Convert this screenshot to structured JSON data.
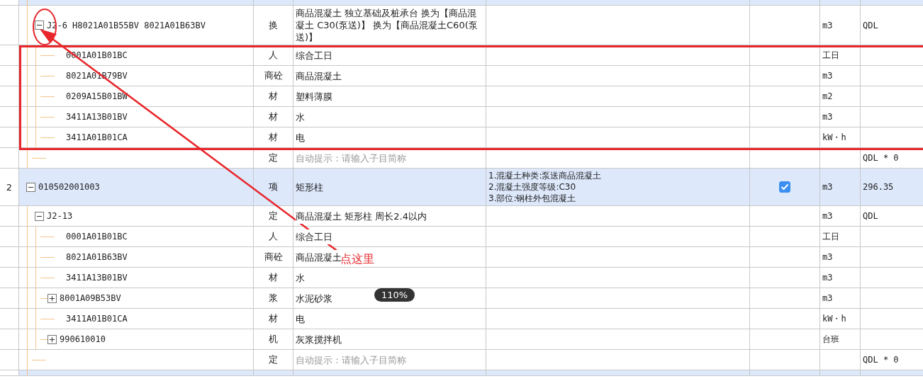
{
  "rows": [
    {
      "kind": "item_cut",
      "children": [
        {
          "kind": "quota",
          "code": "J2-6 H8021A01B55BV 8021A01B63BV",
          "type": "换",
          "name": "商品混凝土 独立基础及桩承台  换为【商品混凝土 C30(泵送)】  换为【商品混凝土C60(泵送)】",
          "unit": "m3",
          "quantity": "QDL",
          "expanded": true,
          "children": [
            {
              "kind": "resource",
              "code": "0001A01B01BC",
              "type": "人",
              "name": "综合工日",
              "unit": "工日"
            },
            {
              "kind": "resource",
              "code": "8021A01B79BV",
              "type": "商砼",
              "name": "商品混凝土",
              "unit": "m3"
            },
            {
              "kind": "resource",
              "code": "0209A15B01BW",
              "type": "材",
              "name": "塑料薄膜",
              "unit": "m2"
            },
            {
              "kind": "resource",
              "code": "3411A13B01BV",
              "type": "材",
              "name": "水",
              "unit": "m3"
            },
            {
              "kind": "resource",
              "code": "3411A01B01CA",
              "type": "材",
              "name": "电",
              "unit": "kW・h"
            }
          ]
        },
        {
          "kind": "hint",
          "type": "定",
          "name": "自动提示：请输入子目简称",
          "quantity": "QDL * 0"
        }
      ]
    },
    {
      "kind": "item",
      "number": "2",
      "code": "010502001003",
      "type": "项",
      "name": "矩形柱",
      "features": [
        "1.混凝土种类:泵送商品混凝土",
        "2.混凝土强度等级:C30",
        "3.部位:钢柱外包混凝土"
      ],
      "checked": true,
      "unit": "m3",
      "quantity": "296.35",
      "expanded": true,
      "children": [
        {
          "kind": "quota",
          "code": "J2-13",
          "type": "定",
          "name": "商品混凝土 矩形柱 周长2.4以内",
          "unit": "m3",
          "quantity": "QDL",
          "expanded": true,
          "children": [
            {
              "kind": "resource",
              "code": "0001A01B01BC",
              "type": "人",
              "name": "综合工日",
              "unit": "工日"
            },
            {
              "kind": "resource",
              "code": "8021A01B63BV",
              "type": "商砼",
              "name": "商品混凝土",
              "unit": "m3"
            },
            {
              "kind": "resource",
              "code": "3411A13B01BV",
              "type": "材",
              "name": "水",
              "unit": "m3"
            },
            {
              "kind": "resource",
              "code": "8001A09B53BV",
              "type": "浆",
              "name": "水泥砂浆",
              "unit": "m3",
              "expanded": false
            },
            {
              "kind": "resource",
              "code": "3411A01B01CA",
              "type": "材",
              "name": "电",
              "unit": "kW・h"
            },
            {
              "kind": "resource",
              "code": "990610010",
              "type": "机",
              "name": "灰浆搅拌机",
              "unit": "台班",
              "expanded": false
            }
          ]
        },
        {
          "kind": "hint",
          "type": "定",
          "name": "自动提示：请输入子目简称",
          "quantity": "QDL * 0"
        }
      ]
    },
    {
      "kind": "item_cut",
      "children": []
    }
  ],
  "annotation": {
    "label": "点这里"
  },
  "zoom_badge": "110%"
}
